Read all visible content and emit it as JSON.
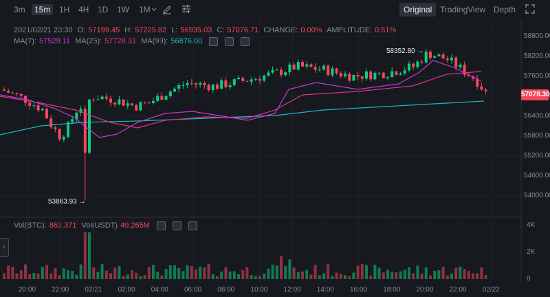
{
  "toolbar": {
    "timeframes": [
      "3m",
      "15m",
      "1H",
      "4H",
      "1D",
      "1W",
      "1M"
    ],
    "active_timeframe": "15m",
    "views": [
      "Original",
      "TradingView",
      "Depth"
    ],
    "active_view": "Original"
  },
  "legend": {
    "datetime": "2021/02/21 23:30",
    "open_label": "O:",
    "open": "57199.45",
    "high_label": "H:",
    "high": "57225.82",
    "low_label": "L:",
    "low": "56935.03",
    "close_label": "C:",
    "close": "57076.71",
    "change_label": "CHANGE:",
    "change": "0.00%",
    "amplitude_label": "AMPLITUDE:",
    "amplitude": "0.51%",
    "ma7_label": "MA(7):",
    "ma7": "57529.11",
    "ma25_label": "MA(25):",
    "ma25": "57728.31",
    "ma99_label": "MA(99):",
    "ma99": "56876.00"
  },
  "volume_legend": {
    "vol_btc_label": "Vol(BTC):",
    "vol_btc": "863.371",
    "vol_usdt_label": "Vol(USDT)",
    "vol_usdt": "49.265M"
  },
  "current_price": "57078.30",
  "annotations": {
    "high": "58352.80",
    "low": "53863.93"
  },
  "price_axis": [
    "58800.00",
    "58200.00",
    "57600.00",
    "57000.00",
    "56400.00",
    "55800.00",
    "55200.00",
    "54600.00",
    "54000.00"
  ],
  "volume_axis": [
    "4K",
    "2K",
    "0"
  ],
  "time_axis": [
    "20:00",
    "22:00",
    "02/21",
    "02:00",
    "04:00",
    "06:00",
    "08:00",
    "10:00",
    "12:00",
    "14:00",
    "16:00",
    "18:00",
    "20:00",
    "22:00",
    "02/22"
  ],
  "colors": {
    "up": "#0ecb81",
    "down": "#f6465d",
    "ma7": "#c837d9",
    "ma25": "#e0318a",
    "ma99": "#1fb4c3",
    "background": "#161a1e"
  }
}
